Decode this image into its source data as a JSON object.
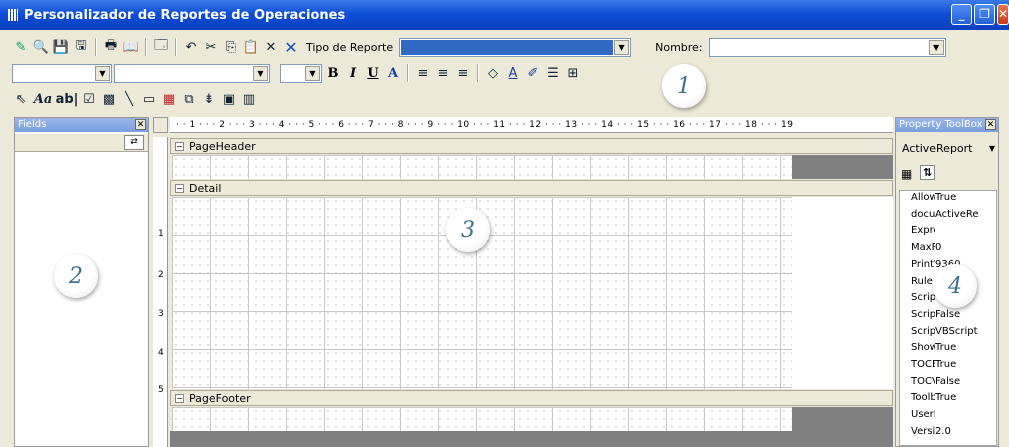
{
  "window": {
    "title": "Personalizador de Reportes de Operaciones"
  },
  "toolbar1": {
    "tipo_label": "Tipo de Reporte",
    "nombre_label": "Nombre:"
  },
  "toolbar2": {
    "bold": "B",
    "italic": "I",
    "underline": "U",
    "color": "A"
  },
  "toolbar3": {
    "aa": "Aa",
    "ab": "ab|"
  },
  "fields_panel": {
    "title": "Fields"
  },
  "ruler": {
    "h_labels": "· · 1 · · · 2 · · · 3 · · · 4 · · · 5 · · · 6 · · · 7 · · · 8 · · · 9 · · · 10 · · · 11 · · · 12 · · · 13 · · · 14 · · · 15 · · · 16 · · · 17 · · · 18 · · · 19",
    "v_labels": [
      "1",
      "2",
      "3",
      "4",
      "5"
    ]
  },
  "sections": {
    "header": "PageHeader",
    "detail": "Detail",
    "footer": "PageFooter"
  },
  "property_toolbox": {
    "title": "Property ToolBox",
    "object": "ActiveReport",
    "rows": [
      {
        "name": "AllowS",
        "value": "True"
      },
      {
        "name": "docum",
        "value": "ActiveRe"
      },
      {
        "name": "Expre",
        "value": ""
      },
      {
        "name": "MaxPa",
        "value": "0"
      },
      {
        "name": "PrintW",
        "value": "9360"
      },
      {
        "name": "Rule",
        "value": ""
      },
      {
        "name": "Scrip",
        "value": ""
      },
      {
        "name": "Script",
        "value": "False"
      },
      {
        "name": "Script",
        "value": "VBScript"
      },
      {
        "name": "Show#",
        "value": "True"
      },
      {
        "name": "TOCEr",
        "value": "True"
      },
      {
        "name": "TOCVi",
        "value": "False"
      },
      {
        "name": "Toolba",
        "value": "True"
      },
      {
        "name": "UserD",
        "value": ""
      },
      {
        "name": "Versio",
        "value": "2.0"
      }
    ]
  },
  "callouts": {
    "c1": "1",
    "c2": "2",
    "c3": "3",
    "c4": "4"
  }
}
